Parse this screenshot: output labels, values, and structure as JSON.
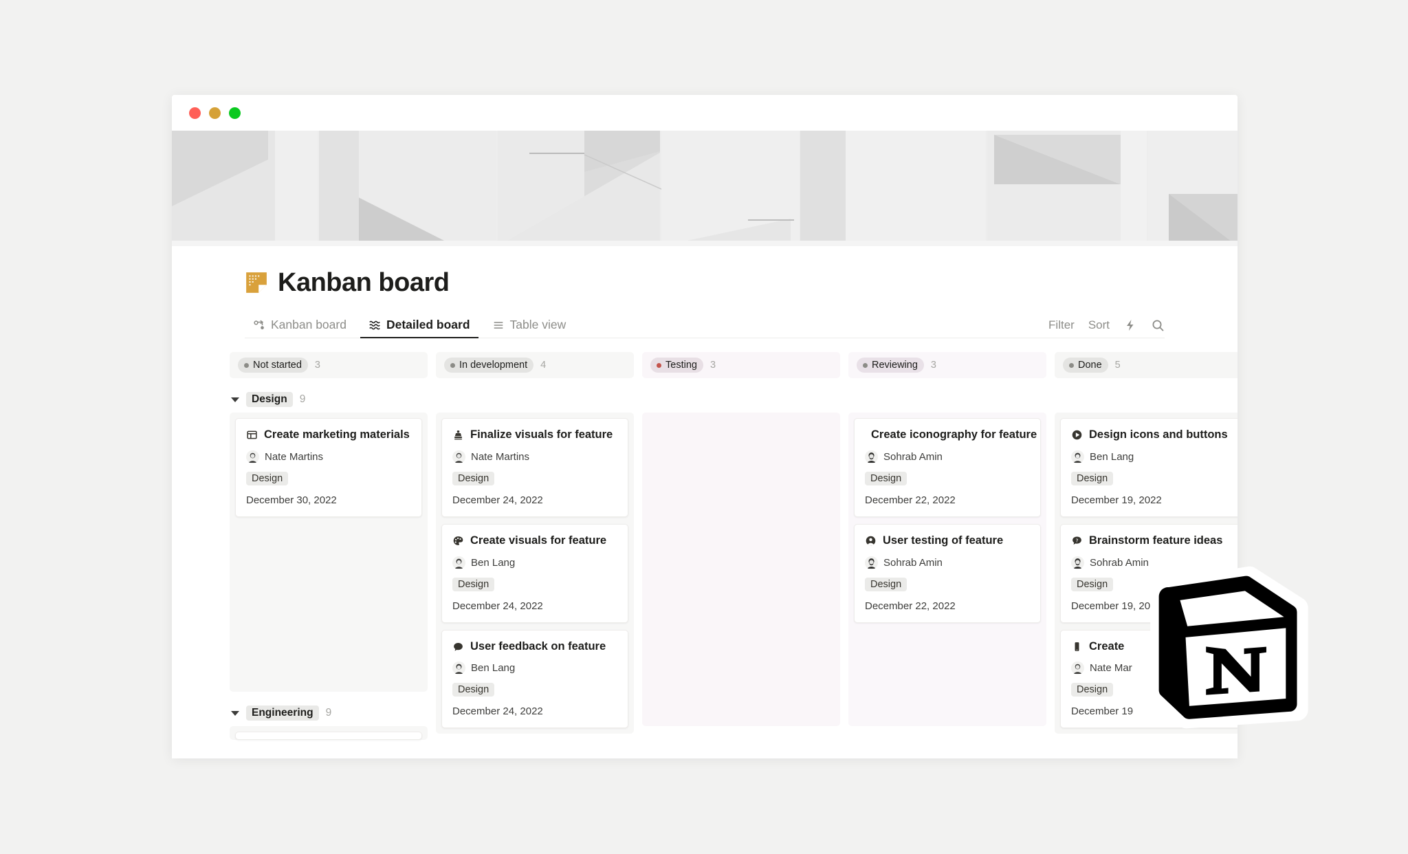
{
  "window": {
    "traffic_lights": [
      "close",
      "minimize",
      "maximize"
    ]
  },
  "page": {
    "icon": "sticky-note-icon",
    "title": "Kanban board"
  },
  "tabs": [
    {
      "label": "Kanban board",
      "icon": "kanban-icon",
      "active": false
    },
    {
      "label": "Detailed board",
      "icon": "detailed-board-icon",
      "active": true
    },
    {
      "label": "Table view",
      "icon": "table-icon",
      "active": false
    }
  ],
  "toolbar": {
    "filter_label": "Filter",
    "sort_label": "Sort",
    "automation_icon": "lightning-icon",
    "search_icon": "search-icon"
  },
  "columns": [
    {
      "status": "Not started",
      "count": "3",
      "dot_color": "#8c8c87",
      "pill_bg": "#e4e4e2",
      "header_bg": "#f7f7f6",
      "body_bg": "#f7f7f6"
    },
    {
      "status": "In development",
      "count": "4",
      "dot_color": "#8c8c87",
      "pill_bg": "#e4e4e2",
      "header_bg": "#f7f7f6",
      "body_bg": "#f7f7f6"
    },
    {
      "status": "Testing",
      "count": "3",
      "dot_color": "#c4554d",
      "pill_bg": "#e6dfe4",
      "header_bg": "#faf6f9",
      "body_bg": "#faf6f9"
    },
    {
      "status": "Reviewing",
      "count": "3",
      "dot_color": "#8c8c87",
      "pill_bg": "#e7e1e7",
      "header_bg": "#faf7fa",
      "body_bg": "#faf7fa"
    },
    {
      "status": "Done",
      "count": "5",
      "dot_color": "#8c8c87",
      "pill_bg": "#e4e4e2",
      "header_bg": "#f6f6f5",
      "body_bg": "#f6f6f5"
    }
  ],
  "groups": [
    {
      "name": "Design",
      "count": "9"
    },
    {
      "name": "Engineering",
      "count": "9"
    }
  ],
  "design_group": {
    "not_started": [
      {
        "icon": "window-icon",
        "title": "Create marketing materials",
        "person": "Nate Martins",
        "avatar": "avatar-nate",
        "tag": "Design",
        "date": "December 30, 2022"
      }
    ],
    "in_development": [
      {
        "icon": "stamp-icon",
        "title": "Finalize visuals for feature",
        "person": "Nate Martins",
        "avatar": "avatar-nate",
        "tag": "Design",
        "date": "December 24, 2022"
      },
      {
        "icon": "palette-icon",
        "title": "Create visuals for feature",
        "person": "Ben Lang",
        "avatar": "avatar-ben",
        "tag": "Design",
        "date": "December 24, 2022"
      },
      {
        "icon": "speech-bubble-icon",
        "title": "User feedback on feature",
        "person": "Ben Lang",
        "avatar": "avatar-ben",
        "tag": "Design",
        "date": "December 24, 2022"
      }
    ],
    "testing": [],
    "reviewing": [
      {
        "icon": "target-icon",
        "title": "Create iconography for feature",
        "person": "Sohrab Amin",
        "avatar": "avatar-sohrab",
        "tag": "Design",
        "date": "December 22, 2022"
      },
      {
        "icon": "person-circle-icon",
        "title": "User testing of feature",
        "person": "Sohrab Amin",
        "avatar": "avatar-sohrab",
        "tag": "Design",
        "date": "December 22, 2022"
      }
    ],
    "done": [
      {
        "icon": "play-circle-icon",
        "title": "Design icons and buttons",
        "person": "Ben Lang",
        "avatar": "avatar-ben",
        "tag": "Design",
        "date": "December 19, 2022"
      },
      {
        "icon": "question-bubble-icon",
        "title": "Brainstorm feature ideas",
        "person": "Sohrab Amin",
        "avatar": "avatar-sohrab",
        "tag": "Design",
        "date": "December 19, 2022"
      },
      {
        "icon": "phone-icon",
        "title": "Create",
        "person": "Nate Mar",
        "avatar": "avatar-nate",
        "tag": "Design",
        "date": "December 19"
      }
    ]
  },
  "brand": {
    "logo": "notion-logo",
    "logo_color": "#000000"
  }
}
